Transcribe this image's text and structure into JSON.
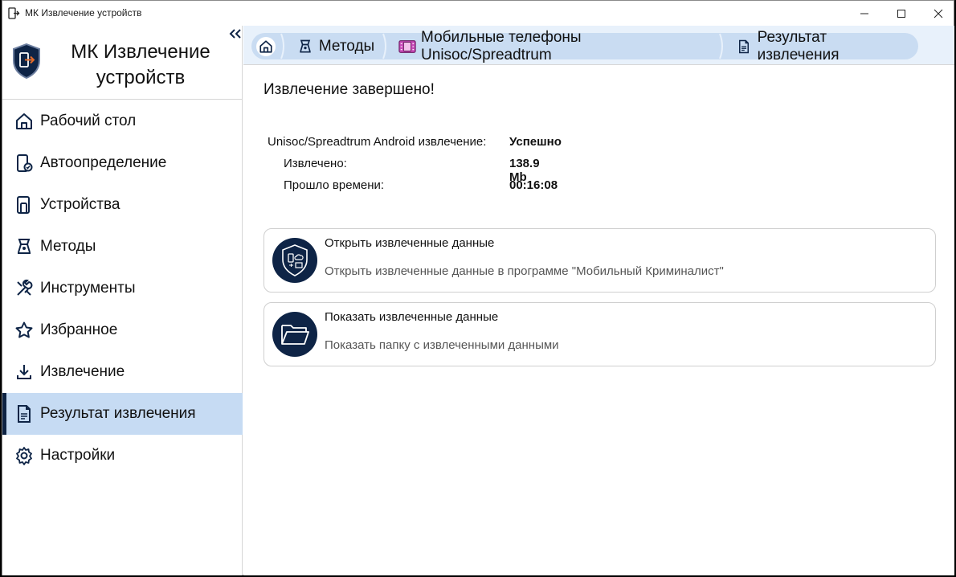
{
  "window": {
    "title": "МК Извлечение устройств"
  },
  "brand": {
    "title_line1": "МК Извлечение",
    "title_line2": "устройств"
  },
  "sidebar": {
    "items": [
      {
        "label": "Рабочий стол",
        "icon": "home-icon"
      },
      {
        "label": "Автоопределение",
        "icon": "device-check-icon"
      },
      {
        "label": "Устройства",
        "icon": "devices-icon"
      },
      {
        "label": "Методы",
        "icon": "methods-icon"
      },
      {
        "label": "Инструменты",
        "icon": "tools-icon"
      },
      {
        "label": "Избранное",
        "icon": "star-icon"
      },
      {
        "label": "Извлечение",
        "icon": "download-icon"
      },
      {
        "label": "Результат извлечения",
        "icon": "document-icon",
        "active": true
      },
      {
        "label": "Настройки",
        "icon": "gear-icon"
      }
    ]
  },
  "breadcrumb": {
    "items": [
      {
        "label": "Методы",
        "icon": "methods-icon"
      },
      {
        "label": "Мобильные телефоны Unisoc/Spreadtrum",
        "icon": "phone-chip-icon"
      },
      {
        "label": "Результат извлечения",
        "icon": "document-icon"
      }
    ]
  },
  "main": {
    "heading": "Извлечение завершено!",
    "info": {
      "status_key": "Unisoc/Spreadtrum Android извлечение:",
      "status_value": "Успешно",
      "extracted_key": "Извлечено:",
      "extracted_value": "138.9 Mb",
      "elapsed_key": "Прошло времени:",
      "elapsed_value": "00:16:08"
    },
    "cards": [
      {
        "title": "Открыть извлеченные данные",
        "desc": "Открыть извлеченные данные в программе \"Мобильный Криминалист\""
      },
      {
        "title": "Показать извлеченные данные",
        "desc": "Показать папку с извлеченными данными"
      }
    ]
  },
  "colors": {
    "accent_dark": "#0e2446",
    "active_bg": "#c6dbf3",
    "breadcrumb_bg": "#c9dcf2"
  }
}
